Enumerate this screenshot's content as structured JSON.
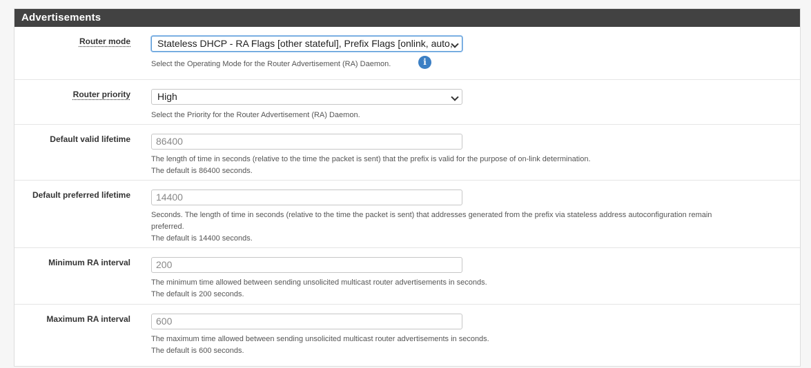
{
  "panel": {
    "title": "Advertisements"
  },
  "rows": {
    "router_mode": {
      "label": "Router mode",
      "value": "Stateless DHCP - RA Flags [other stateful], Prefix Flags [onlink, auto,",
      "help": "Select the Operating Mode for the Router Advertisement (RA) Daemon.",
      "info_icon": "i"
    },
    "router_priority": {
      "label": "Router priority",
      "value": "High",
      "help": "Select the Priority for the Router Advertisement (RA) Daemon."
    },
    "default_valid_lifetime": {
      "label": "Default valid lifetime",
      "placeholder": "86400",
      "help1": "The length of time in seconds (relative to the time the packet is sent) that the prefix is valid for the purpose of on-link determination.",
      "help2": "The default is 86400 seconds."
    },
    "default_preferred_lifetime": {
      "label": "Default preferred lifetime",
      "placeholder": "14400",
      "help1": "Seconds. The length of time in seconds (relative to the time the packet is sent) that addresses generated from the prefix via stateless address autoconfiguration remain",
      "help1b": "preferred.",
      "help2": "The default is 14400 seconds."
    },
    "min_ra_interval": {
      "label": "Minimum RA interval",
      "placeholder": "200",
      "help1": "The minimum time allowed between sending unsolicited multicast router advertisements in seconds.",
      "help2": "The default is 200 seconds."
    },
    "max_ra_interval": {
      "label": "Maximum RA interval",
      "placeholder": "600",
      "help1": "The maximum time allowed between sending unsolicited multicast router advertisements in seconds.",
      "help2": "The default is 600 seconds."
    }
  },
  "colors": {
    "heading_bg": "#424242",
    "info_icon": "#3b7fc4",
    "focus": "#5b9bd5"
  }
}
